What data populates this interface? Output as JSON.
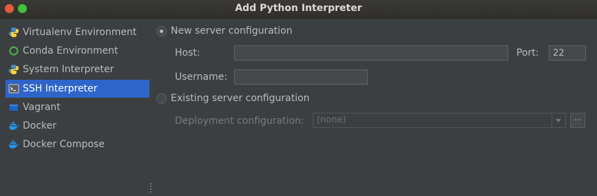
{
  "window": {
    "title": "Add Python Interpreter"
  },
  "sidebar": {
    "items": [
      {
        "label": "Virtualenv Environment",
        "icon": "python-icon",
        "selected": false
      },
      {
        "label": "Conda Environment",
        "icon": "conda-ring-icon",
        "selected": false
      },
      {
        "label": "System Interpreter",
        "icon": "python-icon",
        "selected": false
      },
      {
        "label": "SSH Interpreter",
        "icon": "terminal-icon",
        "selected": true
      },
      {
        "label": "Vagrant",
        "icon": "vagrant-icon",
        "selected": false
      },
      {
        "label": "Docker",
        "icon": "docker-icon",
        "selected": false
      },
      {
        "label": "Docker Compose",
        "icon": "docker-icon",
        "selected": false
      }
    ]
  },
  "form": {
    "new_server_label": "New server configuration",
    "host_label": "Host:",
    "host_value": "",
    "port_label": "Port:",
    "port_value": "22",
    "username_label": "Username:",
    "username_value": "",
    "existing_server_label": "Existing server configuration",
    "deployment_label": "Deployment configuration:",
    "deployment_value": "(none)",
    "browse_button": "..."
  },
  "colors": {
    "selection": "#2f65ca",
    "background": "#3c3f41",
    "close_button": "#e65a3a",
    "maximize_button": "#3fc33c"
  }
}
